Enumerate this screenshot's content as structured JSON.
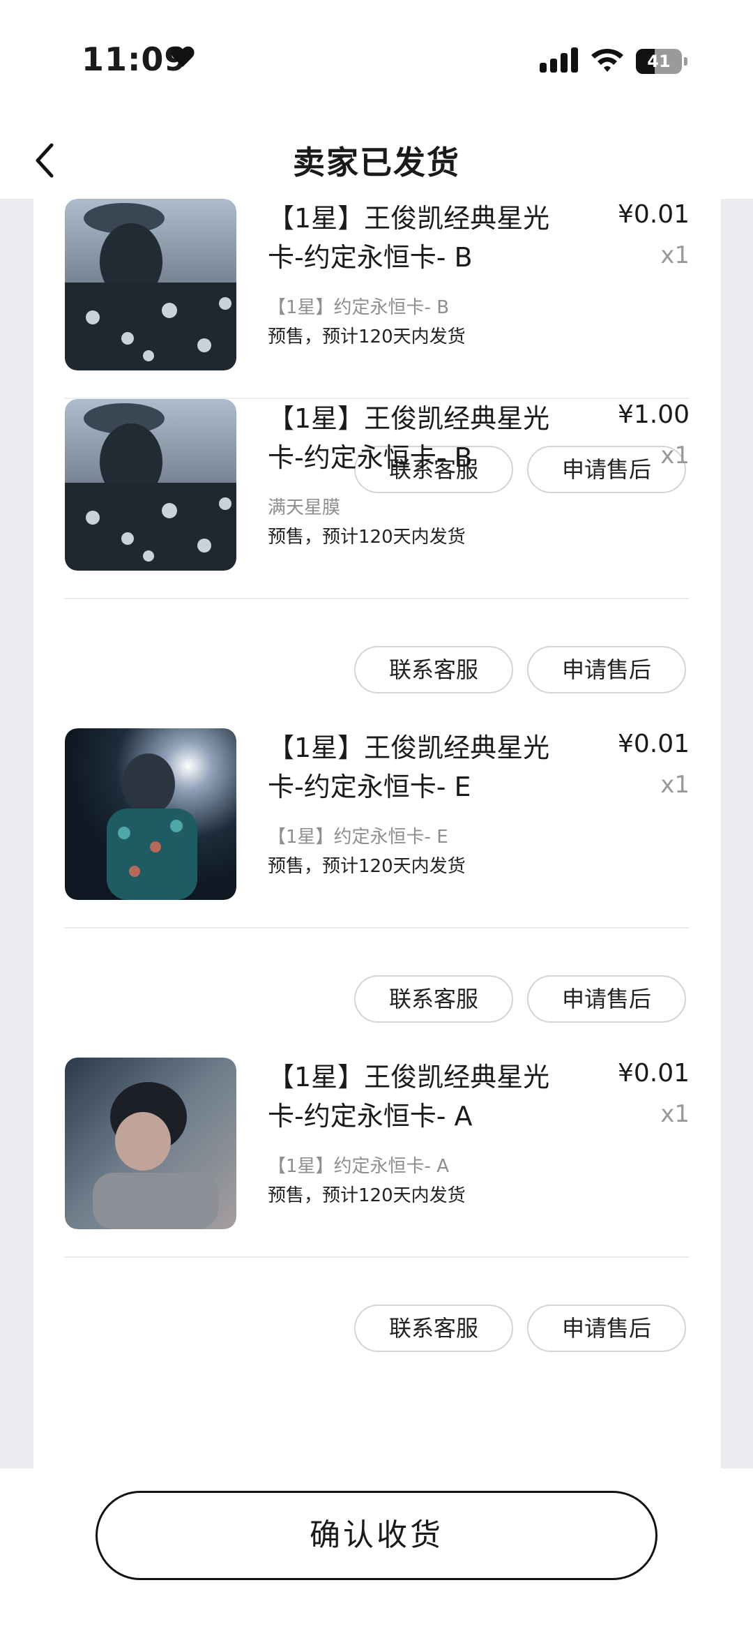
{
  "status_bar": {
    "time": "11:09",
    "battery": "41",
    "battery_level": 0.41
  },
  "header": {
    "title": "卖家已发货"
  },
  "orders": [
    {
      "title": "【1星】王俊凯经典星光卡-约定永恒卡- B",
      "price": "¥0.01",
      "quantity": "x1",
      "spec": "【1星】约定永恒卡- B",
      "note": "预售，预计120天内发货",
      "contact_label": "联系客服",
      "after_sale_label": "申请售后"
    },
    {
      "title": "【1星】王俊凯经典星光卡-约定永恒卡- B",
      "price": "¥1.00",
      "quantity": "x1",
      "spec": "满天星膜",
      "note": "预售，预计120天内发货",
      "contact_label": "联系客服",
      "after_sale_label": "申请售后"
    },
    {
      "title": "【1星】王俊凯经典星光卡-约定永恒卡- E",
      "price": "¥0.01",
      "quantity": "x1",
      "spec": "【1星】约定永恒卡- E",
      "note": "预售，预计120天内发货",
      "contact_label": "联系客服",
      "after_sale_label": "申请售后"
    },
    {
      "title": "【1星】王俊凯经典星光卡-约定永恒卡- A",
      "price": "¥0.01",
      "quantity": "x1",
      "spec": "【1星】约定永恒卡- A",
      "note": "预售，预计120天内发货",
      "contact_label": "联系客服",
      "after_sale_label": "申请售后"
    }
  ],
  "footer": {
    "confirm_label": "确认收货"
  },
  "icons": {
    "back": "chevron-left-icon",
    "heart": "heart-icon",
    "signal": "cellular-signal-icon",
    "wifi": "wifi-icon",
    "battery": "battery-icon"
  }
}
